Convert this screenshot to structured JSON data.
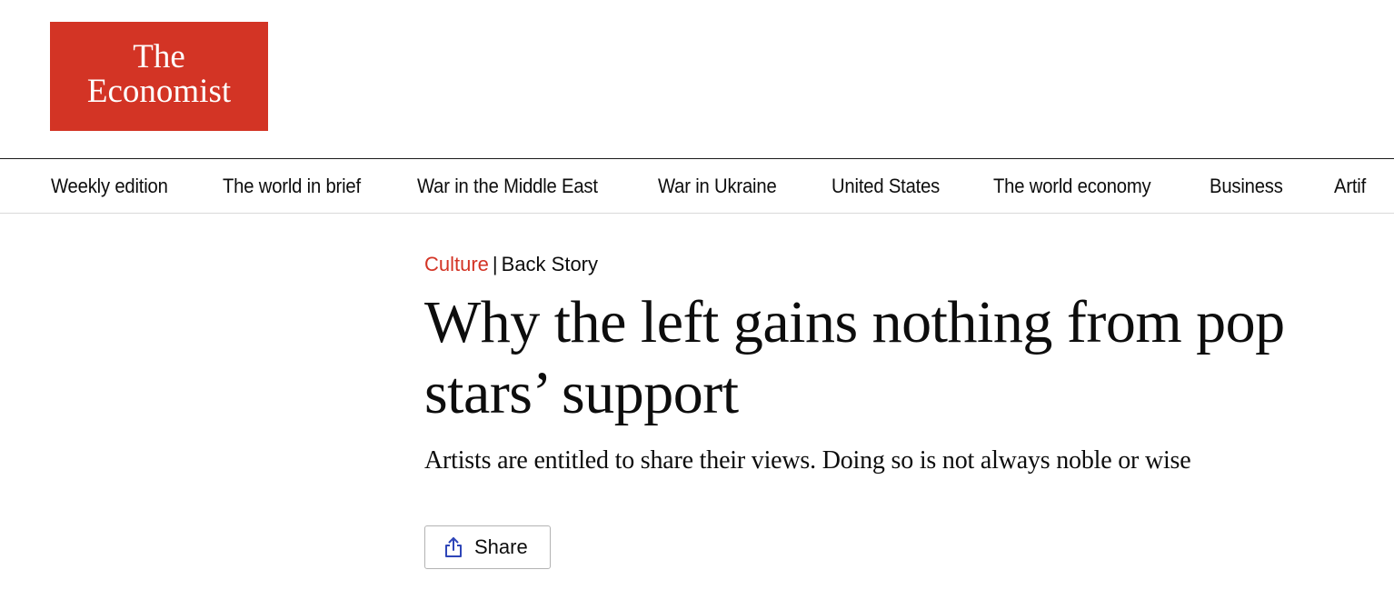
{
  "logo": {
    "line1": "The",
    "line2": "Economist",
    "color": "#d33425"
  },
  "nav": {
    "items": [
      {
        "label": "Weekly edition"
      },
      {
        "label": "The world in brief"
      },
      {
        "label": "War in the Middle East"
      },
      {
        "label": "War in Ukraine"
      },
      {
        "label": "United States"
      },
      {
        "label": "The world economy"
      },
      {
        "label": "Business"
      },
      {
        "label": "Artif"
      }
    ]
  },
  "article": {
    "section": "Culture",
    "separator": "|",
    "column": "Back Story",
    "headline": "Why the left gains nothing from pop stars’ support",
    "subhead": "Artists are entitled to share their views. Doing so is not always noble or wise"
  },
  "share": {
    "label": "Share",
    "icon": "share-icon",
    "icon_color": "#2e45b8"
  }
}
